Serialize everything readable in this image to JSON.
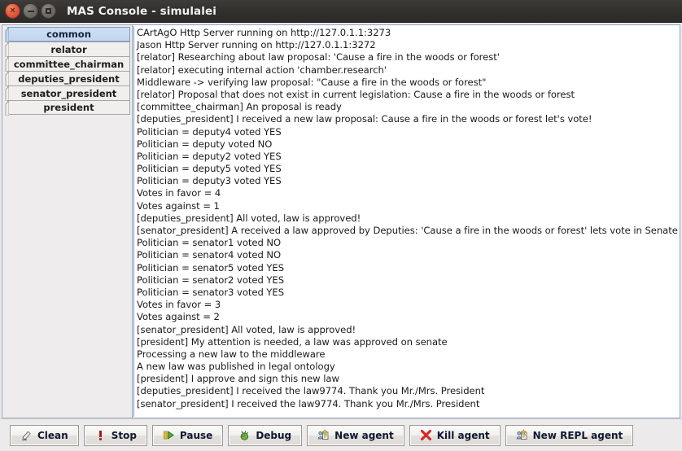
{
  "window": {
    "title": "MAS Console - simulalei",
    "controls": [
      {
        "name": "close",
        "glyph": "×"
      },
      {
        "name": "minimize",
        "glyph": "–"
      },
      {
        "name": "maximize",
        "glyph": "□"
      }
    ]
  },
  "sidebar": {
    "tabs": [
      {
        "label": "common",
        "selected": true
      },
      {
        "label": "relator",
        "selected": false
      },
      {
        "label": "committee_chairman",
        "selected": false
      },
      {
        "label": "deputies_president",
        "selected": false
      },
      {
        "label": "senator_president",
        "selected": false
      },
      {
        "label": "president",
        "selected": false
      }
    ]
  },
  "console": {
    "lines": [
      "CArtAgO Http Server running on http://127.0.1.1:3273",
      "Jason Http Server running on http://127.0.1.1:3272",
      "[relator] Researching about law proposal: 'Cause a fire in the woods or forest'",
      "[relator] executing internal action 'chamber.research'",
      "Middleware -> verifying law proposal: \"Cause a fire in the woods or forest\"",
      "[relator] Proposal that does not exist in current legislation: Cause a fire in the woods or forest",
      "[committee_chairman] An proposal is ready",
      "[deputies_president] I received a new law proposal: Cause a fire in the woods or forest let's vote!",
      "Politician = deputy4 voted YES",
      "Politician = deputy voted NO",
      "Politician = deputy2 voted YES",
      "Politician = deputy5 voted YES",
      "Politician = deputy3 voted YES",
      "Votes in favor = 4",
      "Votes against = 1",
      "[deputies_president] All voted, law is approved!",
      "[senator_president] A received a law approved by Deputies: 'Cause a fire in the woods or forest' lets vote in Senate!",
      "Politician = senator1 voted NO",
      "Politician = senator4 voted NO",
      "Politician = senator5 voted YES",
      "Politician = senator2 voted YES",
      "Politician = senator3 voted YES",
      "Votes in favor = 3",
      "Votes against = 2",
      "[senator_president] All voted, law is approved!",
      "[president] My attention is needed, a law was approved on senate",
      "Processing a new law to the middleware",
      "A new law was published in legal ontology",
      "[president] I approve and sign this new law",
      "[deputies_president] I received the law9774. Thank you Mr./Mrs. President",
      "[senator_president] I received the law9774. Thank you Mr./Mrs. President"
    ]
  },
  "toolbar": {
    "buttons": [
      {
        "label": "Clean",
        "icon": "eraser-icon"
      },
      {
        "label": "Stop",
        "icon": "exclamation-icon"
      },
      {
        "label": "Pause",
        "icon": "pause-play-icon"
      },
      {
        "label": "Debug",
        "icon": "bug-icon"
      },
      {
        "label": "New agent",
        "icon": "new-agent-icon"
      },
      {
        "label": "Kill agent",
        "icon": "red-x-icon"
      },
      {
        "label": "New REPL agent",
        "icon": "new-agent-icon"
      }
    ]
  },
  "colors": {
    "titlebar": "#32302d",
    "close_button": "#e2553a",
    "tab_selected": "#c3d6ef",
    "panel_border": "#8fa3c0",
    "stop_red": "#b01818",
    "kill_red": "#d42a2a",
    "debug_green": "#5e9e34",
    "pause_yellow": "#e8c02a"
  }
}
